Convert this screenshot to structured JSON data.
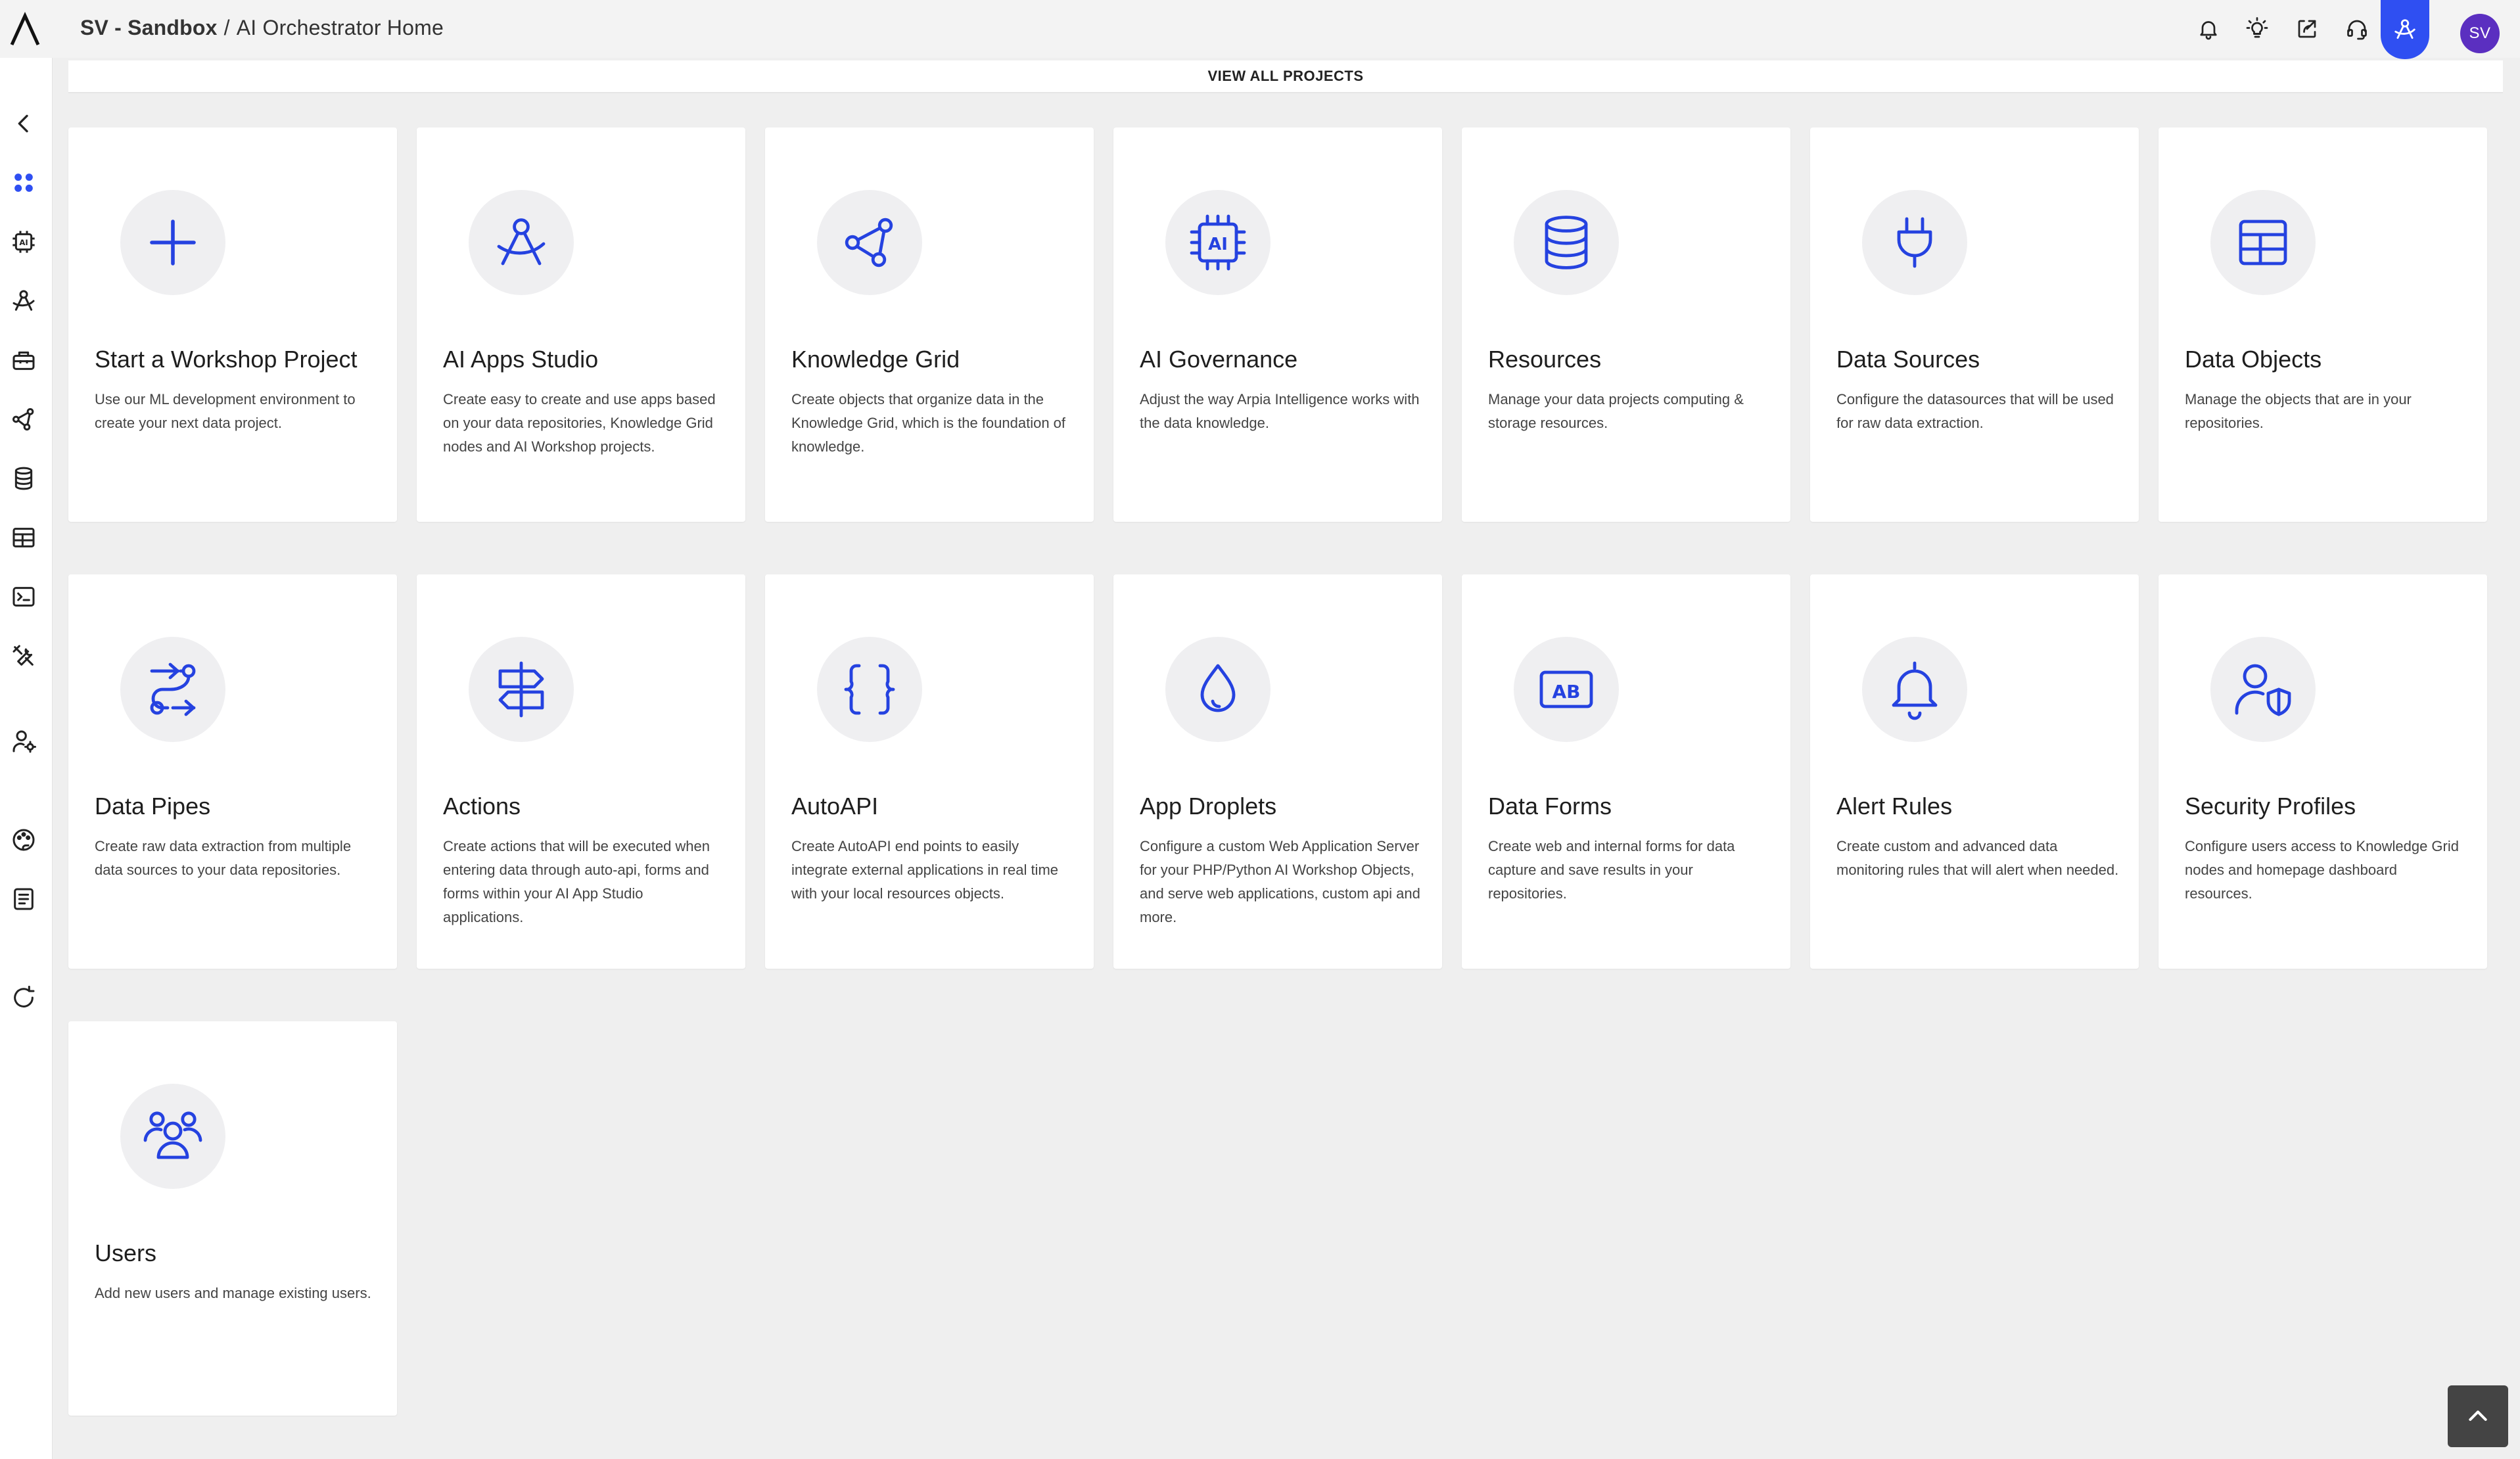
{
  "header": {
    "workspace": "SV - Sandbox",
    "separator": "/",
    "page": "AI Orchestrator Home",
    "avatar_initials": "SV"
  },
  "main": {
    "view_all_label": "VIEW ALL PROJECTS",
    "cards": [
      {
        "icon": "plus-icon",
        "title": "Start a Workshop Project",
        "desc": "Use our ML development environment to create your next data project."
      },
      {
        "icon": "compass-icon",
        "title": "AI Apps Studio",
        "desc": "Create easy to create and use apps based on your data repositories, Knowledge Grid nodes and AI Workshop projects."
      },
      {
        "icon": "network-icon",
        "title": "Knowledge Grid",
        "desc": "Create objects that organize data in the Knowledge Grid, which is the foundation of knowledge."
      },
      {
        "icon": "ai-chip-icon",
        "title": "AI Governance",
        "desc": "Adjust the way Arpia Intelligence works with the data knowledge."
      },
      {
        "icon": "database-icon",
        "title": "Resources",
        "desc": "Manage your data projects computing & storage resources."
      },
      {
        "icon": "plug-icon",
        "title": "Data Sources",
        "desc": "Configure the datasources that will be used for raw data extraction."
      },
      {
        "icon": "table-icon",
        "title": "Data Objects",
        "desc": "Manage the objects that are in your repositories."
      },
      {
        "icon": "route-icon",
        "title": "Data Pipes",
        "desc": "Create raw data extraction from multiple data sources to your data repositories."
      },
      {
        "icon": "signpost-icon",
        "title": "Actions",
        "desc": "Create actions that will be executed when entering data through auto-api, forms and forms within your AI App Studio applications."
      },
      {
        "icon": "braces-icon",
        "title": "AutoAPI",
        "desc": "Create AutoAPI end points to easily integrate external applications in real time with your local resources objects."
      },
      {
        "icon": "droplet-icon",
        "title": "App Droplets",
        "desc": "Configure a custom Web Application Server for your PHP/Python AI Workshop Objects, and serve web applications, custom api and more."
      },
      {
        "icon": "form-ab-icon",
        "title": "Data Forms",
        "desc": "Create web and internal forms for data capture and save results in your repositories."
      },
      {
        "icon": "bell-icon",
        "title": "Alert Rules",
        "desc": "Create custom and advanced data monitoring rules that will alert when needed."
      },
      {
        "icon": "user-shield-icon",
        "title": "Security Profiles",
        "desc": "Configure users access to Knowledge Grid nodes and homepage dashboard resources."
      },
      {
        "icon": "users-icon",
        "title": "Users",
        "desc": "Add new users and manage existing users."
      }
    ]
  },
  "colors": {
    "accent": "#2f4ff2",
    "icon_blue": "#2542e0",
    "avatar": "#5b2fc0",
    "background": "#efefef"
  }
}
